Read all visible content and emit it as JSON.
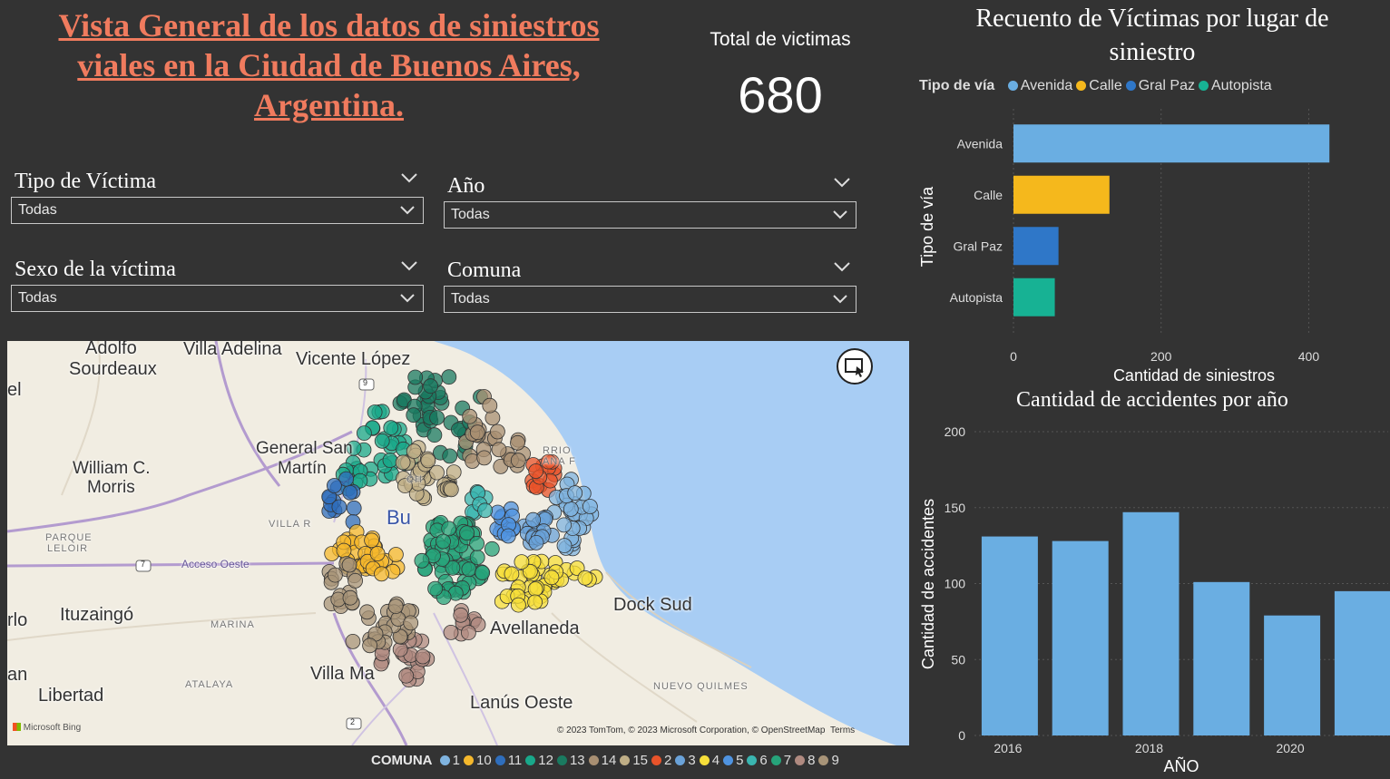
{
  "header": {
    "title": "Vista General de los datos de siniestros viales en la Ciudad de Buenos Aires, Argentina."
  },
  "kpi": {
    "label": "Total de victimas",
    "value": "680"
  },
  "filters": [
    {
      "title": "Tipo de Víctima",
      "value": "Todas"
    },
    {
      "title": "Año",
      "value": "Todas"
    },
    {
      "title": "Sexo de la víctima",
      "value": "Todas"
    },
    {
      "title": "Comuna",
      "value": "Todas"
    }
  ],
  "map": {
    "labels": [
      "Adolfo",
      "Sourdeaux",
      "Villa Adelina",
      "Vicente López",
      "el",
      "General San",
      "Martín",
      "William C.",
      "Morris",
      "VILLA R",
      "PARQUE",
      "LELOIR",
      "Acceso Oeste",
      "Ituzaingó",
      "rlo",
      "MARINA",
      "Dock Sud",
      "Avellaneda",
      "Villa Ma",
      "ATALAYA",
      "an",
      "Libertad",
      "NUEVO QUILMES",
      "Lanús Oeste",
      "RRIO",
      "ANA F",
      "CH",
      "Bu",
      "9",
      "7",
      "2"
    ],
    "credit": "© 2023 TomTom, © 2023 Microsoft Corporation, © OpenStreetMap",
    "terms": "Terms",
    "bing": "Microsoft Bing",
    "legend_title": "COMUNA",
    "comunas": [
      {
        "name": "1",
        "color": "#7fb3df"
      },
      {
        "name": "10",
        "color": "#f5b82c"
      },
      {
        "name": "11",
        "color": "#2f6ebc"
      },
      {
        "name": "12",
        "color": "#19a88a"
      },
      {
        "name": "13",
        "color": "#1a7a60"
      },
      {
        "name": "14",
        "color": "#a88f72"
      },
      {
        "name": "15",
        "color": "#bfae86"
      },
      {
        "name": "2",
        "color": "#e8532a"
      },
      {
        "name": "3",
        "color": "#6aa2d8"
      },
      {
        "name": "4",
        "color": "#f7df3a"
      },
      {
        "name": "5",
        "color": "#4f93e0"
      },
      {
        "name": "6",
        "color": "#3ab5b0"
      },
      {
        "name": "7",
        "color": "#26a37a"
      },
      {
        "name": "8",
        "color": "#b08a80"
      },
      {
        "name": "9",
        "color": "#a89478"
      }
    ]
  },
  "chart_data": [
    {
      "type": "bar",
      "orientation": "horizontal",
      "title": "Recuento de Víctimas por lugar de siniestro",
      "legend_title": "Tipo de vía",
      "categories": [
        "Avenida",
        "Calle",
        "Gral Paz",
        "Autopista"
      ],
      "values": [
        428,
        130,
        61,
        56
      ],
      "colors": [
        "#6aaee2",
        "#f5b81c",
        "#2f77c8",
        "#17b294"
      ],
      "xlabel": "Cantidad de siniestros",
      "ylabel": "Tipo de vía",
      "xlim": [
        0,
        440
      ],
      "xticks": [
        0,
        200,
        400
      ]
    },
    {
      "type": "bar",
      "title": "Cantidad de accidentes por año",
      "categories": [
        2016,
        2017,
        2018,
        2019,
        2020,
        2021
      ],
      "tick_labels": [
        "2016",
        "",
        "2018",
        "",
        "2020",
        ""
      ],
      "values": [
        131,
        128,
        147,
        101,
        79,
        95
      ],
      "color": "#6aaee2",
      "xlabel": "AÑO",
      "ylabel": "Cantidad de accidentes",
      "ylim": [
        0,
        200
      ],
      "yticks": [
        0,
        50,
        100,
        150,
        200
      ]
    }
  ]
}
